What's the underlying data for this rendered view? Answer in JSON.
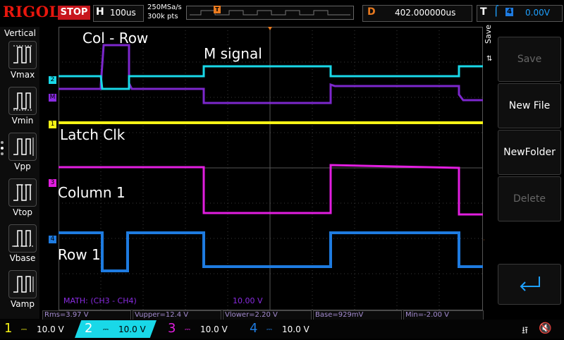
{
  "brand": "RIGOL",
  "run_state": "STOP",
  "horizontal": {
    "label": "H",
    "timebase": "100us",
    "sample_rate": "250MSa/s",
    "points": "300k pts"
  },
  "timeline_marker": "T",
  "delay": {
    "label": "D",
    "value": "402.000000us"
  },
  "trigger": {
    "label": "T",
    "source": "4",
    "level": "0.00V"
  },
  "measure_panel": {
    "title": "Vertical",
    "items": [
      {
        "label": "Vmax",
        "icon": "vmax-waveform-icon"
      },
      {
        "label": "Vmin",
        "icon": "vmin-waveform-icon"
      },
      {
        "label": "Vpp",
        "icon": "vpp-waveform-icon"
      },
      {
        "label": "Vtop",
        "icon": "vtop-waveform-icon"
      },
      {
        "label": "Vbase",
        "icon": "vbase-waveform-icon"
      },
      {
        "label": "Vamp",
        "icon": "vamp-waveform-icon"
      }
    ]
  },
  "annotations": {
    "col_row": "Col - Row",
    "m_signal": "M signal",
    "latch_clk": "Latch Clk",
    "column1": "Column 1",
    "row1": "Row 1"
  },
  "channel_markers": {
    "ch2": "2",
    "math": "M",
    "ch1": "1",
    "ch3": "3",
    "ch4": "4"
  },
  "math": {
    "label": "MATH: (CH3 - CH4)",
    "scale": "10.00 V"
  },
  "save_menu": {
    "tab": "Save",
    "buttons": [
      {
        "label": "Save",
        "enabled": false
      },
      {
        "label": "New File",
        "enabled": true
      },
      {
        "label": "NewFolder",
        "enabled": true
      },
      {
        "label": "Delete",
        "enabled": false
      }
    ],
    "enter_icon": "enter-arrow-icon"
  },
  "stats": {
    "rms": "Rms=3.97 V",
    "vupper": "Vupper=12.4 V",
    "vlower": "Vlower=2.20 V",
    "base": "Base=929mV",
    "min": "Min=-2.00 V"
  },
  "channels": [
    {
      "num": "1",
      "scale": "10.0 V",
      "color": "#f5f316"
    },
    {
      "num": "2",
      "scale": "10.0 V",
      "color": "#19d8e8"
    },
    {
      "num": "3",
      "scale": "10.0 V",
      "color": "#e21ee0"
    },
    {
      "num": "4",
      "scale": "10.0 V",
      "color": "#1e7be0"
    }
  ],
  "colors": {
    "ch1": "#f5f316",
    "ch2": "#19d8e8",
    "ch3": "#e21ee0",
    "ch4": "#1e7be0",
    "math": "#8a2be2",
    "accent": "#e97a1f",
    "stop": "#c8161d"
  },
  "icons": {
    "usb": "usb-icon",
    "speaker": "speaker-muted-icon"
  }
}
